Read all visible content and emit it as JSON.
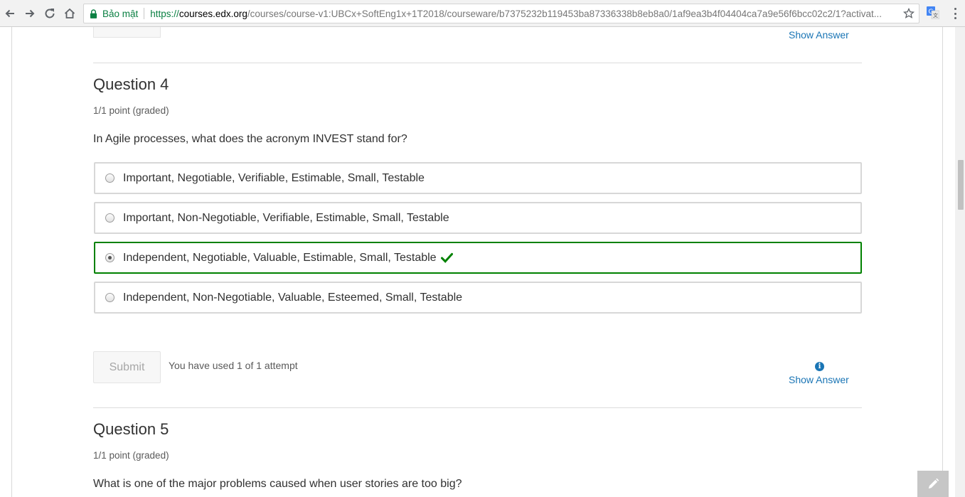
{
  "browser": {
    "secure_label": "Bảo mật",
    "url_proto": "https://",
    "url_host": "courses.edx.org",
    "url_path": "/courses/course-v1:UBCx+SoftEng1x+1T2018/courseware/b7375232b119453ba87336338b8eb8a0/1af9ea3b4f04404ca7a9e56f6bcc02c2/1?activat..."
  },
  "prev_question": {
    "show_answer": "Show Answer"
  },
  "question4": {
    "title": "Question 4",
    "points": "1/1 point (graded)",
    "prompt": "In Agile processes, what does the acronym INVEST stand for?",
    "choices": [
      {
        "label": "Important, Negotiable, Verifiable, Estimable, Small, Testable"
      },
      {
        "label": "Important, Non-Negotiable, Verifiable, Estimable, Small, Testable"
      },
      {
        "label": "Independent, Negotiable, Valuable, Estimable, Small, Testable"
      },
      {
        "label": "Independent, Non-Negotiable, Valuable, Esteemed, Small, Testable"
      }
    ],
    "selected_index": 2,
    "submit_label": "Submit",
    "attempts": "You have used 1 of 1 attempt",
    "show_answer": "Show Answer"
  },
  "question5": {
    "title": "Question 5",
    "points": "1/1 point (graded)",
    "prompt": "What is one of the major problems caused when user stories are too big?"
  },
  "colors": {
    "link": "#1a75b5",
    "correct": "#008100",
    "secure": "#0b8043"
  }
}
